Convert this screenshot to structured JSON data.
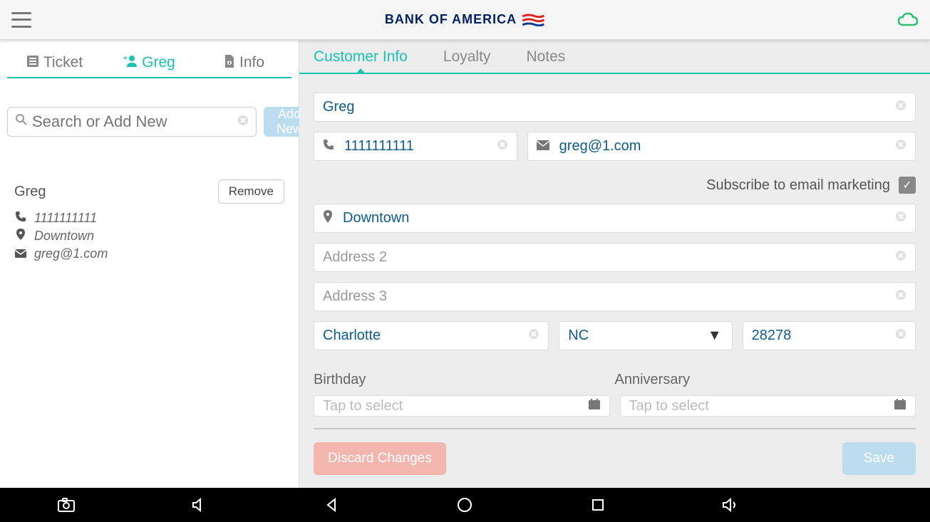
{
  "header": {
    "brand": "BANK OF AMERICA"
  },
  "sidebar": {
    "tabs": {
      "ticket": "Ticket",
      "customer": "Greg",
      "info": "Info"
    },
    "search_placeholder": "Search or Add New",
    "add_new": "Add New",
    "customer": {
      "name": "Greg",
      "phone": "1111111111",
      "address": "Downtown",
      "email": "greg@1.com"
    },
    "remove": "Remove"
  },
  "main": {
    "tabs": {
      "info": "Customer Info",
      "loyalty": "Loyalty",
      "notes": "Notes"
    },
    "form": {
      "name": "Greg",
      "phone": "1111111111",
      "email": "greg@1.com",
      "subscribe_label": "Subscribe to email marketing",
      "subscribe_checked": true,
      "address1": "Downtown",
      "address2_ph": "Address 2",
      "address3_ph": "Address 3",
      "city": "Charlotte",
      "state": "NC",
      "zip": "28278",
      "birthday_label": "Birthday",
      "anniversary_label": "Anniversary",
      "date_placeholder": "Tap to select"
    },
    "actions": {
      "discard": "Discard Changes",
      "save": "Save"
    }
  }
}
